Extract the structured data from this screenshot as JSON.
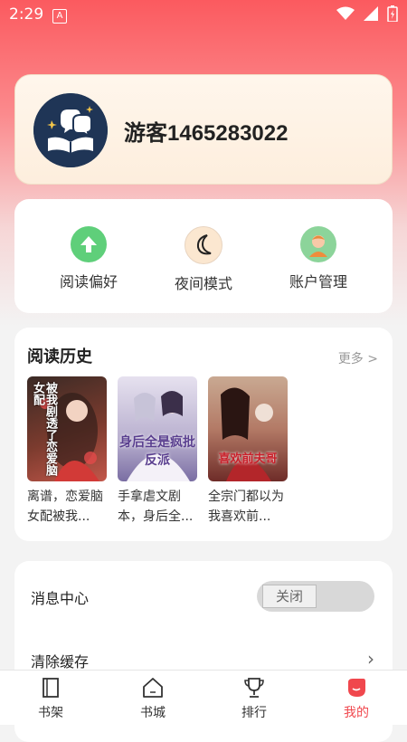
{
  "status_bar": {
    "time": "2:29",
    "notification_letter": "A"
  },
  "profile": {
    "username": "游客1465283022",
    "avatar_icon": "reading-avatar-icon"
  },
  "actions": [
    {
      "label": "阅读偏好",
      "icon": "arrow-up-icon",
      "color": "#5fcf7a"
    },
    {
      "label": "夜间模式",
      "icon": "moon-icon",
      "color": "#fbe7d0"
    },
    {
      "label": "账户管理",
      "icon": "user-icon",
      "color": "#8cd49a"
    }
  ],
  "history": {
    "title": "阅读历史",
    "more": "更多 >",
    "books": [
      {
        "title": "离谱，恋爱脑女配被我...",
        "cover_text": "被我剧透了恋爱脑女配"
      },
      {
        "title": "手拿虐文剧本，身后全...",
        "cover_text": "身后全是疯批反派"
      },
      {
        "title": "全宗门都以为我喜欢前...",
        "cover_text": "喜欢前夫哥"
      }
    ]
  },
  "settings": {
    "message_center": "消息中心",
    "message_toggle": "关闭",
    "clear_cache": "清除缓存"
  },
  "tabs": [
    {
      "label": "书架",
      "icon": "bookshelf-icon"
    },
    {
      "label": "书城",
      "icon": "bookstore-icon"
    },
    {
      "label": "排行",
      "icon": "trophy-icon"
    },
    {
      "label": "我的",
      "icon": "profile-icon",
      "active": true
    }
  ],
  "colors": {
    "accent": "#f0474d",
    "header_start": "#fb5a5f"
  }
}
